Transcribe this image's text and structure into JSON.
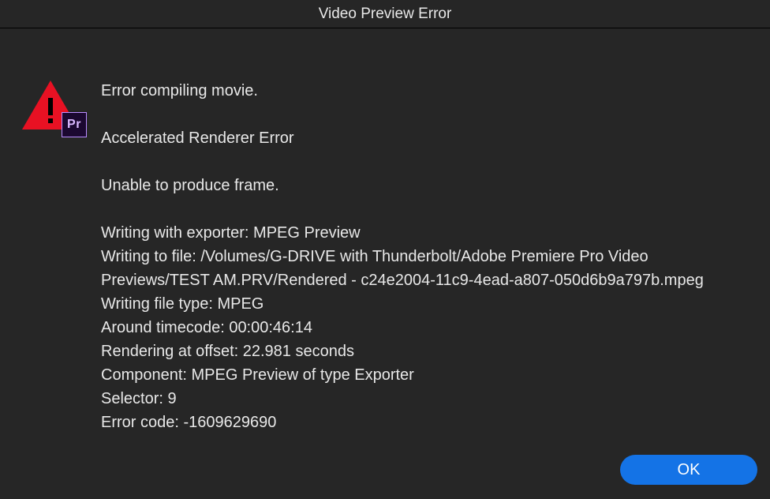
{
  "dialog": {
    "title": "Video Preview Error",
    "icon": {
      "warning_color": "#e81123",
      "app_label": "Pr"
    },
    "message": {
      "line1": "Error compiling movie.",
      "line2": "Accelerated Renderer Error",
      "line3": "Unable to produce frame.",
      "exporter_line": "Writing with exporter: MPEG Preview",
      "file_line": "Writing to file: /Volumes/G-DRIVE with Thunderbolt/Adobe Premiere Pro Video Previews/TEST AM.PRV/Rendered - c24e2004-11c9-4ead-a807-050d6b9a797b.mpeg",
      "filetype_line": "Writing file type: MPEG",
      "timecode_line": "Around timecode: 00:00:46:14",
      "offset_line": "Rendering at offset: 22.981 seconds",
      "component_line": "Component: MPEG Preview of type Exporter",
      "selector_line": "Selector: 9",
      "errorcode_line": "Error code: -1609629690"
    },
    "ok_label": "OK"
  }
}
